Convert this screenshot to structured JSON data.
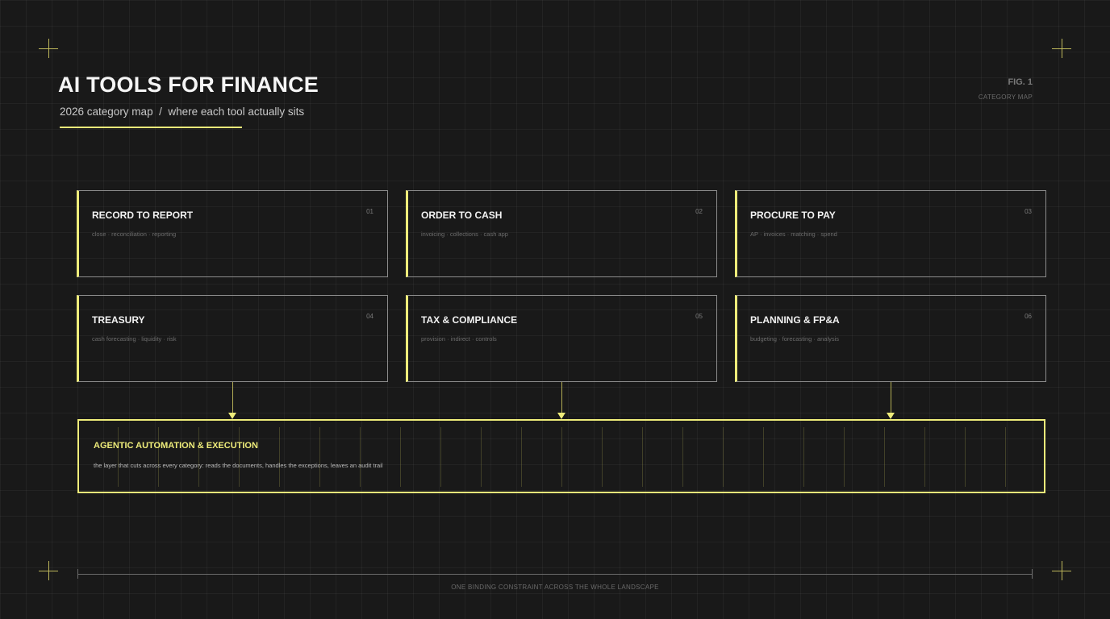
{
  "header": {
    "title": "AI TOOLS FOR FINANCE",
    "subtitle": "2026 category map  /  where each tool actually sits",
    "fig_label": "FIG. 1",
    "fig_caption": "CATEGORY MAP"
  },
  "categories": [
    {
      "title": "RECORD TO REPORT",
      "number": "01",
      "tags": "close · reconciliation · reporting"
    },
    {
      "title": "ORDER TO CASH",
      "number": "02",
      "tags": "invoicing · collections · cash app"
    },
    {
      "title": "PROCURE TO PAY",
      "number": "03",
      "tags": "AP · invoices · matching · spend"
    },
    {
      "title": "TREASURY",
      "number": "04",
      "tags": "cash forecasting · liquidity · risk"
    },
    {
      "title": "TAX & COMPLIANCE",
      "number": "05",
      "tags": "provision · indirect · controls"
    },
    {
      "title": "PLANNING & FP&A",
      "number": "06",
      "tags": "budgeting · forecasting · analysis"
    }
  ],
  "layer": {
    "title": "AGENTIC AUTOMATION & EXECUTION",
    "description": "the layer that cuts across every category: reads the documents, handles the exceptions, leaves an audit trail"
  },
  "footer": {
    "caption": "ONE BINDING CONSTRAINT ACROSS THE WHOLE LANDSCAPE"
  },
  "colors": {
    "background": "#191919",
    "accent": "#eeec7a",
    "border": "#8c8c8c"
  }
}
